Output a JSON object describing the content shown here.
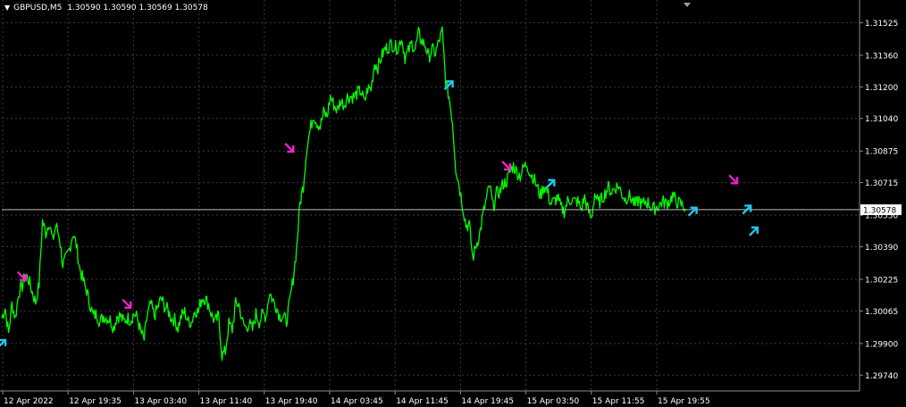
{
  "header": {
    "symbol": "GBPUSD,M5",
    "ohlc": "1.30590 1.30590 1.30569 1.30578"
  },
  "colors": {
    "background": "#000000",
    "price_line": "#00ff00",
    "grid": "#3a3a3a",
    "axis": "#8c8c8c",
    "buy_arrow": "#22c7ee",
    "sell_arrow": "#ee22cc",
    "text": "#ffffff"
  },
  "chart_data": {
    "type": "line",
    "grid": true,
    "ylim": [
      1.2966,
      1.3164
    ],
    "y_ticks": [
      "1.31525",
      "1.31360",
      "1.31200",
      "1.31040",
      "1.30875",
      "1.30715",
      "1.30550",
      "1.30390",
      "1.30225",
      "1.30065",
      "1.29900",
      "1.29740"
    ],
    "y_tick_values": [
      1.31525,
      1.3136,
      1.312,
      1.3104,
      1.30875,
      1.30715,
      1.3055,
      1.3039,
      1.30225,
      1.30065,
      1.299,
      1.2974
    ],
    "x_ticks": [
      "12 Apr 2022",
      "12 Apr 19:35",
      "13 Apr 03:40",
      "13 Apr 11:40",
      "13 Apr 19:40",
      "14 Apr 03:45",
      "14 Apr 11:45",
      "14 Apr 19:45",
      "15 Apr 03:50",
      "15 Apr 11:55",
      "15 Apr 19:55"
    ],
    "current_price": 1.30578,
    "current_price_label": "1.30578",
    "series": [
      {
        "values": [
          1.3003,
          1.3008,
          1.2995,
          1.301,
          1.3003,
          1.3016,
          1.3019,
          1.3025,
          1.3022,
          1.3016,
          1.3011,
          1.302,
          1.3052,
          1.3046,
          1.3052,
          1.3042,
          1.305,
          1.3044,
          1.303,
          1.3033,
          1.3038,
          1.3046,
          1.304,
          1.3028,
          1.3022,
          1.3017,
          1.301,
          1.3004,
          1.3005,
          1.3001,
          1.3004,
          1.3003,
          1.3002,
          1.2998,
          1.3004,
          1.3004,
          1.3001,
          1.3003,
          1.3002,
          1.3005,
          1.3003,
          1.2996,
          1.2992,
          1.3005,
          1.301,
          1.3004,
          1.3008,
          1.3013,
          1.3009,
          1.3007,
          1.3003,
          1.3002,
          1.2998,
          1.3004,
          1.3006,
          1.3001,
          1.3001,
          1.3007,
          1.3006,
          1.3013,
          1.3013,
          1.301,
          1.3004,
          1.3001,
          1.3004,
          1.2984,
          1.2986,
          1.3,
          1.2997,
          1.301,
          1.301,
          1.3001,
          1.2998,
          1.3,
          1.2997,
          1.3005,
          1.3001,
          1.3005,
          1.3004,
          1.3016,
          1.3012,
          1.3009,
          1.3004,
          1.3004,
          1.3001,
          1.3011,
          1.3023,
          1.3038,
          1.3061,
          1.307,
          1.3089,
          1.3098,
          1.3106,
          1.3102,
          1.31,
          1.3107,
          1.3105,
          1.3115,
          1.3111,
          1.3108,
          1.3113,
          1.3111,
          1.3115,
          1.3115,
          1.3115,
          1.3117,
          1.3118,
          1.3112,
          1.3119,
          1.3119,
          1.3132,
          1.313,
          1.3135,
          1.3139,
          1.314,
          1.3142,
          1.314,
          1.314,
          1.3145,
          1.3135,
          1.3138,
          1.3142,
          1.3139,
          1.3147,
          1.3143,
          1.3141,
          1.3135,
          1.3139,
          1.3137,
          1.3143,
          1.3148,
          1.3123,
          1.3115,
          1.3103,
          1.3079,
          1.307,
          1.306,
          1.305,
          1.305,
          1.3033,
          1.304,
          1.3045,
          1.3055,
          1.3063,
          1.307,
          1.3059,
          1.3066,
          1.3067,
          1.3071,
          1.3072,
          1.3077,
          1.308,
          1.3077,
          1.3075,
          1.3079,
          1.3081,
          1.3076,
          1.3074,
          1.3069,
          1.3065,
          1.307,
          1.3067,
          1.3061,
          1.3062,
          1.3064,
          1.3059,
          1.3057,
          1.3062,
          1.3063,
          1.3062,
          1.3062,
          1.3058,
          1.3064,
          1.3058,
          1.3053,
          1.3066,
          1.3061,
          1.3063,
          1.3066,
          1.3069,
          1.3067,
          1.3069,
          1.307,
          1.3066,
          1.3063,
          1.3065,
          1.3063,
          1.306,
          1.3063,
          1.306,
          1.3062,
          1.3061,
          1.3058,
          1.3059,
          1.306,
          1.3062,
          1.3061,
          1.3062,
          1.3065,
          1.3062,
          1.3061,
          1.306,
          1.3058
        ]
      }
    ],
    "signals": [
      {
        "type": "buy",
        "index": 0,
        "price": 1.299
      },
      {
        "type": "sell",
        "index": 6,
        "price": 1.3024
      },
      {
        "type": "sell",
        "index": 37,
        "price": 1.301
      },
      {
        "type": "sell",
        "index": 85,
        "price": 1.3089
      },
      {
        "type": "buy",
        "index": 132,
        "price": 1.3121
      },
      {
        "type": "sell",
        "index": 149,
        "price": 1.308
      },
      {
        "type": "buy",
        "index": 162,
        "price": 1.3071
      },
      {
        "type": "buy",
        "index": 204,
        "price": 1.3057
      },
      {
        "type": "sell",
        "index": 216,
        "price": 1.3073
      },
      {
        "type": "buy",
        "index": 220,
        "price": 1.3058
      },
      {
        "type": "buy",
        "index": 222,
        "price": 1.3047
      }
    ]
  }
}
